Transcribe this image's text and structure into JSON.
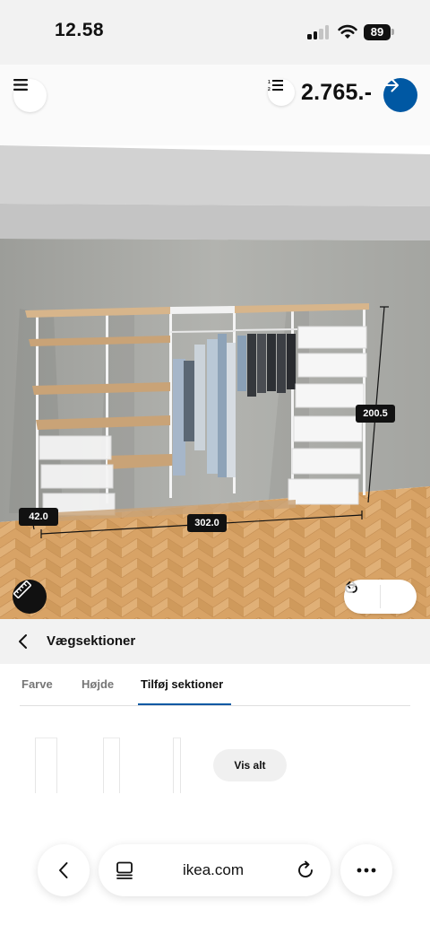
{
  "status_bar": {
    "time": "12.58",
    "battery": "89"
  },
  "header": {
    "price": "2.765.-"
  },
  "scene": {
    "dimensions": {
      "depth": "42.0",
      "width": "302.0",
      "height": "200.5"
    }
  },
  "section": {
    "title": "Vægsektioner"
  },
  "tabs": [
    {
      "label": "Farve",
      "active": false
    },
    {
      "label": "Højde",
      "active": false
    },
    {
      "label": "Tilføj sektioner",
      "active": true
    }
  ],
  "options": {
    "see_all_label": "Vis alt"
  },
  "browser": {
    "url": "ikea.com"
  },
  "colors": {
    "ikea_blue": "#0058a3",
    "wall": "#a9aaa6",
    "floor": "#d9a567"
  },
  "icons": {
    "menu": "menu-icon",
    "list": "list-icon",
    "next": "arrow-right-icon",
    "ruler": "ruler-icon",
    "undo": "undo-icon",
    "redo": "redo-icon",
    "back": "chevron-left-icon",
    "tabs": "tabs-icon",
    "reload": "reload-icon",
    "more": "more-icon"
  }
}
